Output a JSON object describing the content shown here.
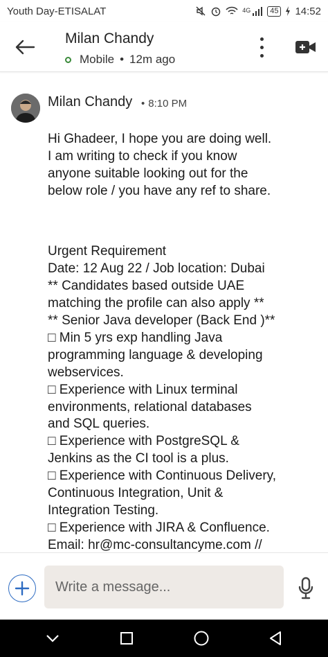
{
  "status_bar": {
    "carrier": "Youth Day-ETISALAT",
    "network": "4G",
    "battery": "45",
    "time": "14:52"
  },
  "header": {
    "contact_name": "Milan Chandy",
    "device": "Mobile",
    "last_seen": "12m ago"
  },
  "message": {
    "sender": "Milan Chandy",
    "separator": "•",
    "time": "8:10 PM",
    "intro": "Hi Ghadeer, I hope you are doing well.\nI am writing to check if you know\nanyone suitable looking out for the\nbelow role / you have any ref to share.",
    "body": "Urgent Requirement\nDate: 12 Aug 22 / Job location: Dubai\n** Candidates based outside UAE\nmatching the profile can also apply **\n** Senior Java developer (Back End )**\n□  Min 5 yrs exp handling Java\nprogramming language & developing\nwebservices.\n□  Experience with Linux terminal\nenvironments, relational databases\nand SQL queries.\n□  Experience with PostgreSQL &\nJenkins as the CI tool is a plus.\n□  Experience with Continuous Delivery,\nContinuous Integration, Unit &\nIntegration Testing.\n□  Experience with JIRA & Confluence.\nEmail: hr@mc-consultancyme.com //\nShortlisted candidates will be\ncontacted."
  },
  "compose": {
    "placeholder": "Write a message..."
  },
  "colors": {
    "accent": "#2d6bc2",
    "presence": "#3a8a3a",
    "input_bg": "#eeeae6",
    "nav_bg": "#000000"
  },
  "icons": [
    "back-arrow-icon",
    "more-options-icon",
    "video-call-icon",
    "add-icon",
    "microphone-icon",
    "nav-back-icon",
    "nav-home-icon",
    "nav-recents-icon"
  ]
}
